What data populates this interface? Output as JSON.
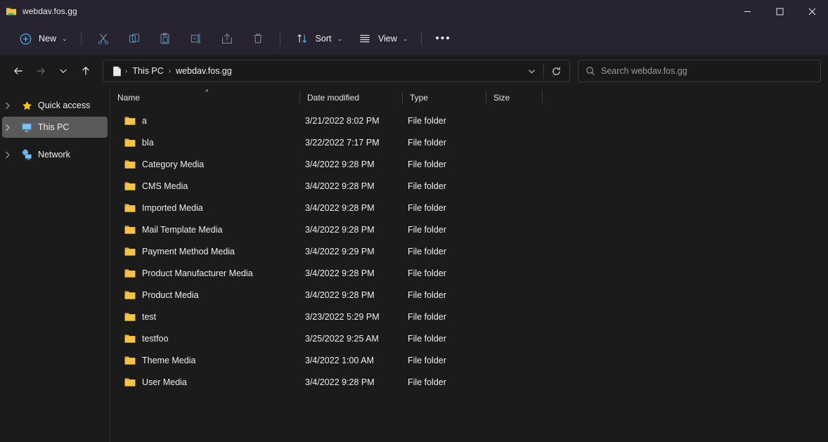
{
  "window": {
    "title": "webdav.fos.gg",
    "icon": "folder-network-icon",
    "minimize_label": "—",
    "maximize_label": "☐",
    "close_label": "✕"
  },
  "toolbar": {
    "new_label": "New",
    "new_icon": "plus-circle-icon",
    "cut_icon": "scissors-icon",
    "copy_icon": "copy-icon",
    "paste_icon": "paste-icon",
    "rename_icon": "rename-icon",
    "share_icon": "share-icon",
    "delete_icon": "trash-icon",
    "sort_label": "Sort",
    "sort_icon": "sort-arrows-icon",
    "view_label": "View",
    "view_icon": "view-list-icon",
    "overflow_label": "•••",
    "chevron": "⌄"
  },
  "address": {
    "back_icon": "arrow-left-icon",
    "forward_icon": "arrow-right-icon",
    "recent_icon": "chevron-down-icon",
    "up_icon": "arrow-up-icon",
    "path_icon": "document-icon",
    "breadcrumbs": [
      "This PC",
      "webdav.fos.gg"
    ],
    "separator": "›",
    "dropdown_icon": "chevron-down-icon",
    "refresh_icon": "refresh-icon"
  },
  "search": {
    "icon": "search-icon",
    "placeholder": "Search webdav.fos.gg",
    "value": ""
  },
  "sidebar": {
    "items": [
      {
        "label": "Quick access",
        "icon": "star-icon",
        "selected": false,
        "expander": "›"
      },
      {
        "label": "This PC",
        "icon": "monitor-icon",
        "selected": true,
        "expander": "›"
      },
      {
        "label": "Network",
        "icon": "network-icon",
        "selected": false,
        "expander": "›"
      }
    ]
  },
  "filelist": {
    "columns": [
      {
        "label": "Name",
        "sorted": "asc",
        "sort_caret": "˄"
      },
      {
        "label": "Date modified",
        "sorted": ""
      },
      {
        "label": "Type",
        "sorted": ""
      },
      {
        "label": "Size",
        "sorted": ""
      }
    ],
    "rows": [
      {
        "name": "a",
        "date": "3/21/2022 8:02 PM",
        "type": "File folder",
        "size": "",
        "icon": "folder-icon"
      },
      {
        "name": "bla",
        "date": "3/22/2022 7:17 PM",
        "type": "File folder",
        "size": "",
        "icon": "folder-icon"
      },
      {
        "name": "Category Media",
        "date": "3/4/2022 9:28 PM",
        "type": "File folder",
        "size": "",
        "icon": "folder-icon"
      },
      {
        "name": "CMS Media",
        "date": "3/4/2022 9:28 PM",
        "type": "File folder",
        "size": "",
        "icon": "folder-icon"
      },
      {
        "name": "Imported Media",
        "date": "3/4/2022 9:28 PM",
        "type": "File folder",
        "size": "",
        "icon": "folder-icon"
      },
      {
        "name": "Mail Template Media",
        "date": "3/4/2022 9:28 PM",
        "type": "File folder",
        "size": "",
        "icon": "folder-icon"
      },
      {
        "name": "Payment Method Media",
        "date": "3/4/2022 9:29 PM",
        "type": "File folder",
        "size": "",
        "icon": "folder-icon"
      },
      {
        "name": "Product Manufacturer Media",
        "date": "3/4/2022 9:28 PM",
        "type": "File folder",
        "size": "",
        "icon": "folder-icon"
      },
      {
        "name": "Product Media",
        "date": "3/4/2022 9:28 PM",
        "type": "File folder",
        "size": "",
        "icon": "folder-icon"
      },
      {
        "name": "test",
        "date": "3/23/2022 5:29 PM",
        "type": "File folder",
        "size": "",
        "icon": "folder-icon"
      },
      {
        "name": "testfoo",
        "date": "3/25/2022 9:25 AM",
        "type": "File folder",
        "size": "",
        "icon": "folder-icon"
      },
      {
        "name": "Theme Media",
        "date": "3/4/2022 1:00 AM",
        "type": "File folder",
        "size": "",
        "icon": "folder-icon"
      },
      {
        "name": "User Media",
        "date": "3/4/2022 9:28 PM",
        "type": "File folder",
        "size": "",
        "icon": "folder-icon"
      }
    ]
  },
  "colors": {
    "titlebar_bg": "#272331",
    "content_bg": "#1b1b1b",
    "accent_blue": "#4cc2ff",
    "folder_yellow": "#f6c34a",
    "selection_grey": "#5a5a5a",
    "text_primary": "#eeeeee",
    "text_muted": "#9a9a9a"
  }
}
